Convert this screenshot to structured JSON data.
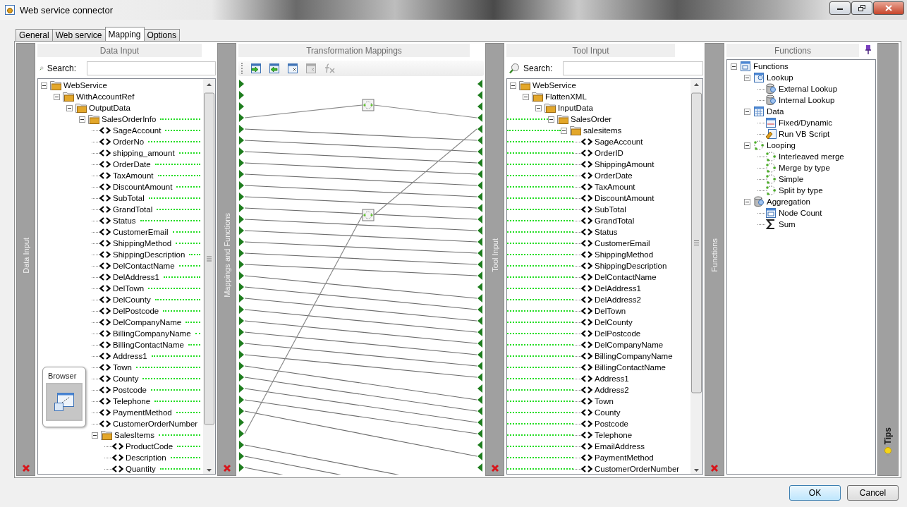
{
  "window": {
    "title": "Web service connector"
  },
  "tabs": [
    {
      "label": "General",
      "selected": false
    },
    {
      "label": "Web service",
      "selected": false
    },
    {
      "label": "Mapping",
      "selected": true
    },
    {
      "label": "Options",
      "selected": false
    }
  ],
  "data_input": {
    "strip_label": "Data Input",
    "header": "Data Input",
    "search_label": "Search:",
    "tree": [
      {
        "label": "WebService",
        "kind": "folder",
        "expanded": true,
        "mapped": false,
        "children": [
          {
            "label": "WithAccountRef",
            "kind": "folder",
            "expanded": true,
            "mapped": false,
            "children": [
              {
                "label": "OutputData",
                "kind": "folder",
                "expanded": true,
                "mapped": false,
                "children": [
                  {
                    "label": "SalesOrderInfo",
                    "kind": "folder",
                    "expanded": true,
                    "mapped": true,
                    "children": [
                      {
                        "label": "SageAccount",
                        "kind": "field",
                        "mapped": true
                      },
                      {
                        "label": "OrderNo",
                        "kind": "field",
                        "mapped": true
                      },
                      {
                        "label": "shipping_amount",
                        "kind": "field",
                        "mapped": true
                      },
                      {
                        "label": "OrderDate",
                        "kind": "field",
                        "mapped": true
                      },
                      {
                        "label": "TaxAmount",
                        "kind": "field",
                        "mapped": true
                      },
                      {
                        "label": "DiscountAmount",
                        "kind": "field",
                        "mapped": true
                      },
                      {
                        "label": "SubTotal",
                        "kind": "field",
                        "mapped": true
                      },
                      {
                        "label": "GrandTotal",
                        "kind": "field",
                        "mapped": true
                      },
                      {
                        "label": "Status",
                        "kind": "field",
                        "mapped": true
                      },
                      {
                        "label": "CustomerEmail",
                        "kind": "field",
                        "mapped": true
                      },
                      {
                        "label": "ShippingMethod",
                        "kind": "field",
                        "mapped": true
                      },
                      {
                        "label": "ShippingDescription",
                        "kind": "field",
                        "mapped": true
                      },
                      {
                        "label": "DelContactName",
                        "kind": "field",
                        "mapped": true
                      },
                      {
                        "label": "DelAddress1",
                        "kind": "field",
                        "mapped": true
                      },
                      {
                        "label": "DelTown",
                        "kind": "field",
                        "mapped": true
                      },
                      {
                        "label": "DelCounty",
                        "kind": "field",
                        "mapped": true
                      },
                      {
                        "label": "DelPostcode",
                        "kind": "field",
                        "mapped": true
                      },
                      {
                        "label": "DelCompanyName",
                        "kind": "field",
                        "mapped": true
                      },
                      {
                        "label": "BillingCompanyName",
                        "kind": "field",
                        "mapped": true
                      },
                      {
                        "label": "BillingContactName",
                        "kind": "field",
                        "mapped": true
                      },
                      {
                        "label": "Address1",
                        "kind": "field",
                        "mapped": true
                      },
                      {
                        "label": "Town",
                        "kind": "field",
                        "mapped": true
                      },
                      {
                        "label": "County",
                        "kind": "field",
                        "mapped": true
                      },
                      {
                        "label": "Postcode",
                        "kind": "field",
                        "mapped": true
                      },
                      {
                        "label": "Telephone",
                        "kind": "field",
                        "mapped": true
                      },
                      {
                        "label": "PaymentMethod",
                        "kind": "field",
                        "mapped": true
                      },
                      {
                        "label": "CustomerOrderNumber",
                        "kind": "field",
                        "mapped": false
                      },
                      {
                        "label": "SalesItems",
                        "kind": "folder",
                        "expanded": true,
                        "mapped": true,
                        "children": [
                          {
                            "label": "ProductCode",
                            "kind": "field",
                            "mapped": true
                          },
                          {
                            "label": "Description",
                            "kind": "field",
                            "mapped": true
                          },
                          {
                            "label": "Quantity",
                            "kind": "field",
                            "mapped": true
                          }
                        ]
                      }
                    ]
                  }
                ]
              }
            ]
          }
        ]
      }
    ]
  },
  "browser": {
    "label": "Browser"
  },
  "mappings": {
    "strip_label": "Mappings and Functions",
    "header": "Transformation Mappings",
    "toolbar": [
      {
        "disabled": false
      },
      {
        "disabled": false
      },
      {
        "disabled": false
      },
      {
        "disabled": true
      },
      {
        "disabled": true
      }
    ]
  },
  "tool_input": {
    "strip_label": "Tool Input",
    "header": "Tool Input",
    "search_label": "Search:",
    "tree": [
      {
        "label": "WebService",
        "kind": "folder",
        "expanded": true,
        "mapped": false,
        "children": [
          {
            "label": "FlattenXML",
            "kind": "folder",
            "expanded": true,
            "mapped": false,
            "children": [
              {
                "label": "InputData",
                "kind": "folder",
                "expanded": true,
                "mapped": false,
                "children": [
                  {
                    "label": "SalesOrder",
                    "kind": "folder",
                    "expanded": true,
                    "mapped": true,
                    "children": [
                      {
                        "label": "salesitems",
                        "kind": "folder",
                        "expanded": true,
                        "mapped": true,
                        "children": [
                          {
                            "label": "SageAccount",
                            "kind": "field",
                            "mapped": true
                          },
                          {
                            "label": "OrderID",
                            "kind": "field",
                            "mapped": true
                          },
                          {
                            "label": "ShippingAmount",
                            "kind": "field",
                            "mapped": true
                          },
                          {
                            "label": "OrderDate",
                            "kind": "field",
                            "mapped": true
                          },
                          {
                            "label": "TaxAmount",
                            "kind": "field",
                            "mapped": true
                          },
                          {
                            "label": "DiscountAmount",
                            "kind": "field",
                            "mapped": true
                          },
                          {
                            "label": "SubTotal",
                            "kind": "field",
                            "mapped": true
                          },
                          {
                            "label": "GrandTotal",
                            "kind": "field",
                            "mapped": true
                          },
                          {
                            "label": "Status",
                            "kind": "field",
                            "mapped": true
                          },
                          {
                            "label": "CustomerEmail",
                            "kind": "field",
                            "mapped": true
                          },
                          {
                            "label": "ShippingMethod",
                            "kind": "field",
                            "mapped": true
                          },
                          {
                            "label": "ShippingDescription",
                            "kind": "field",
                            "mapped": true
                          },
                          {
                            "label": "DelContactName",
                            "kind": "field",
                            "mapped": true
                          },
                          {
                            "label": "DelAddress1",
                            "kind": "field",
                            "mapped": true
                          },
                          {
                            "label": "DelAddress2",
                            "kind": "field",
                            "mapped": true
                          },
                          {
                            "label": "DelTown",
                            "kind": "field",
                            "mapped": true
                          },
                          {
                            "label": "DelCounty",
                            "kind": "field",
                            "mapped": true
                          },
                          {
                            "label": "DelPostcode",
                            "kind": "field",
                            "mapped": true
                          },
                          {
                            "label": "DelCompanyName",
                            "kind": "field",
                            "mapped": true
                          },
                          {
                            "label": "BillingCompanyName",
                            "kind": "field",
                            "mapped": true
                          },
                          {
                            "label": "BillingContactName",
                            "kind": "field",
                            "mapped": true
                          },
                          {
                            "label": "Address1",
                            "kind": "field",
                            "mapped": true
                          },
                          {
                            "label": "Address2",
                            "kind": "field",
                            "mapped": true
                          },
                          {
                            "label": "Town",
                            "kind": "field",
                            "mapped": true
                          },
                          {
                            "label": "County",
                            "kind": "field",
                            "mapped": true
                          },
                          {
                            "label": "Postcode",
                            "kind": "field",
                            "mapped": true
                          },
                          {
                            "label": "Telephone",
                            "kind": "field",
                            "mapped": true
                          },
                          {
                            "label": "EmailAddress",
                            "kind": "field",
                            "mapped": true
                          },
                          {
                            "label": "PaymentMethod",
                            "kind": "field",
                            "mapped": true
                          },
                          {
                            "label": "CustomerOrderNumber",
                            "kind": "field",
                            "mapped": true
                          }
                        ]
                      }
                    ]
                  }
                ]
              }
            ]
          }
        ]
      }
    ]
  },
  "functions": {
    "strip_label": "Functions",
    "header": "Functions",
    "tree": [
      {
        "label": "Functions",
        "kind": "folder",
        "expanded": true,
        "children": [
          {
            "label": "Lookup",
            "kind": "folder",
            "expanded": true,
            "children": [
              {
                "label": "External Lookup",
                "kind": "item"
              },
              {
                "label": "Internal Lookup",
                "kind": "item"
              }
            ]
          },
          {
            "label": "Data",
            "kind": "folder",
            "expanded": true,
            "children": [
              {
                "label": "Fixed/Dynamic",
                "kind": "item"
              },
              {
                "label": "Run VB Script",
                "kind": "item"
              }
            ]
          },
          {
            "label": "Looping",
            "kind": "folder",
            "expanded": true,
            "children": [
              {
                "label": "Interleaved merge",
                "kind": "item"
              },
              {
                "label": "Merge by type",
                "kind": "item"
              },
              {
                "label": "Simple",
                "kind": "item"
              },
              {
                "label": "Split by type",
                "kind": "item"
              }
            ]
          },
          {
            "label": "Aggregation",
            "kind": "folder",
            "expanded": true,
            "children": [
              {
                "label": "Node Count",
                "kind": "item"
              },
              {
                "label": "Sum",
                "kind": "item"
              }
            ]
          }
        ]
      }
    ]
  },
  "tips": {
    "label": "Tips"
  },
  "buttons": [
    {
      "label": "OK",
      "default": true
    },
    {
      "label": "Cancel",
      "default": false
    }
  ]
}
